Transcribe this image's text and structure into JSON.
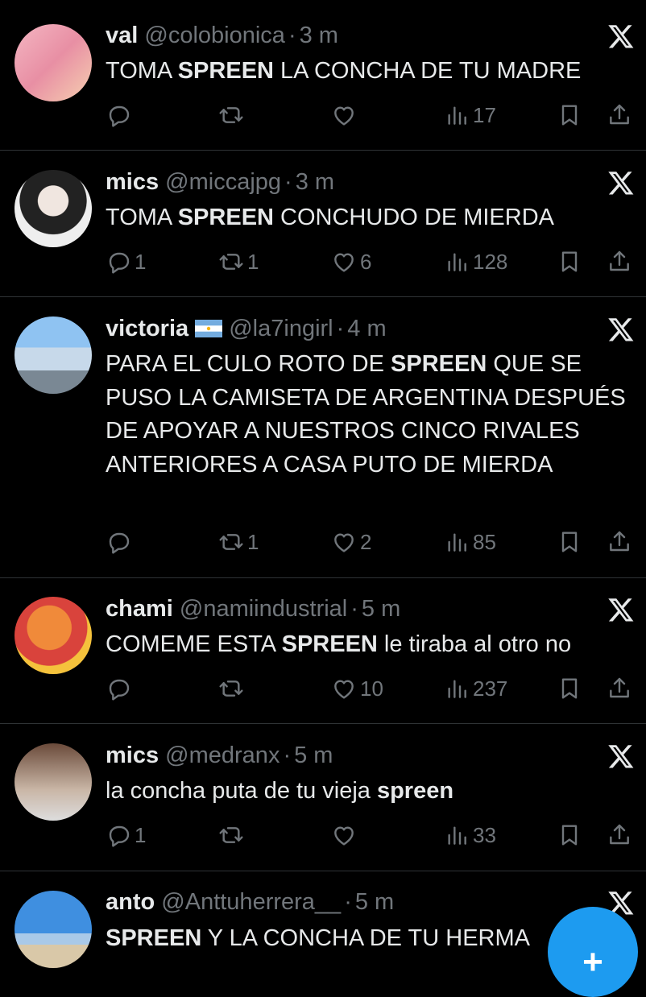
{
  "tweets": [
    {
      "name": "val",
      "handle": "@colobionica",
      "sep": "·",
      "time": "3 m",
      "flag": false,
      "text_before": "TOMA ",
      "text_bold": "SPREEN",
      "text_after": " LA CONCHA DE TU MADRE",
      "replies": "",
      "reposts": "",
      "likes": "",
      "views": "17"
    },
    {
      "name": "mics",
      "handle": "@miccajpg",
      "sep": "·",
      "time": "3 m",
      "flag": false,
      "text_before": "TOMA ",
      "text_bold": "SPREEN",
      "text_after": " CONCHUDO DE MIERDA",
      "replies": "1",
      "reposts": "1",
      "likes": "6",
      "views": "128"
    },
    {
      "name": "victoria",
      "handle": "@la7ingirl",
      "sep": "·",
      "time": "4 m",
      "flag": true,
      "text_before": "PARA EL CULO ROTO DE ",
      "text_bold": "SPREEN",
      "text_after": " QUE SE PUSO LA CAMISETA DE ARGENTINA DESPUÉS DE APOYAR A NUESTROS CINCO RIVALES ANTERIORES A CASA PUTO DE MIERDA",
      "replies": "",
      "reposts": "1",
      "likes": "2",
      "views": "85"
    },
    {
      "name": "chami",
      "handle": "@namiindustrial",
      "sep": "·",
      "time": "5 m",
      "flag": false,
      "text_before": "COMEME ESTA ",
      "text_bold": "SPREEN",
      "text_after": " le tiraba al otro no",
      "replies": "",
      "reposts": "",
      "likes": "10",
      "views": "237"
    },
    {
      "name": "mics",
      "handle": "@medranx",
      "sep": "·",
      "time": "5 m",
      "flag": false,
      "text_before": "la concha puta de tu vieja ",
      "text_bold": "spreen",
      "text_after": "",
      "replies": "1",
      "reposts": "",
      "likes": "",
      "views": "33"
    },
    {
      "name": "anto",
      "handle": "@Anttuherrera__",
      "sep": "·",
      "time": "5 m",
      "flag": false,
      "text_before": "",
      "text_bold": "SPREEN",
      "text_after": " Y LA CONCHA DE TU HERMA",
      "replies": "",
      "reposts": "",
      "likes": "",
      "views": ""
    }
  ],
  "icons": {
    "reply": "reply-icon",
    "repost": "repost-icon",
    "like": "heart-icon",
    "views": "views-icon",
    "bookmark": "bookmark-icon",
    "share": "share-icon",
    "platform": "x-logo-icon",
    "flag": "argentina-flag-icon",
    "compose": "plus-icon"
  },
  "compose_label": "+",
  "colors": {
    "background": "#000000",
    "text": "#e7e9ea",
    "secondary": "#71767b",
    "divider": "#2f3336",
    "accent": "#1d9bf0"
  }
}
